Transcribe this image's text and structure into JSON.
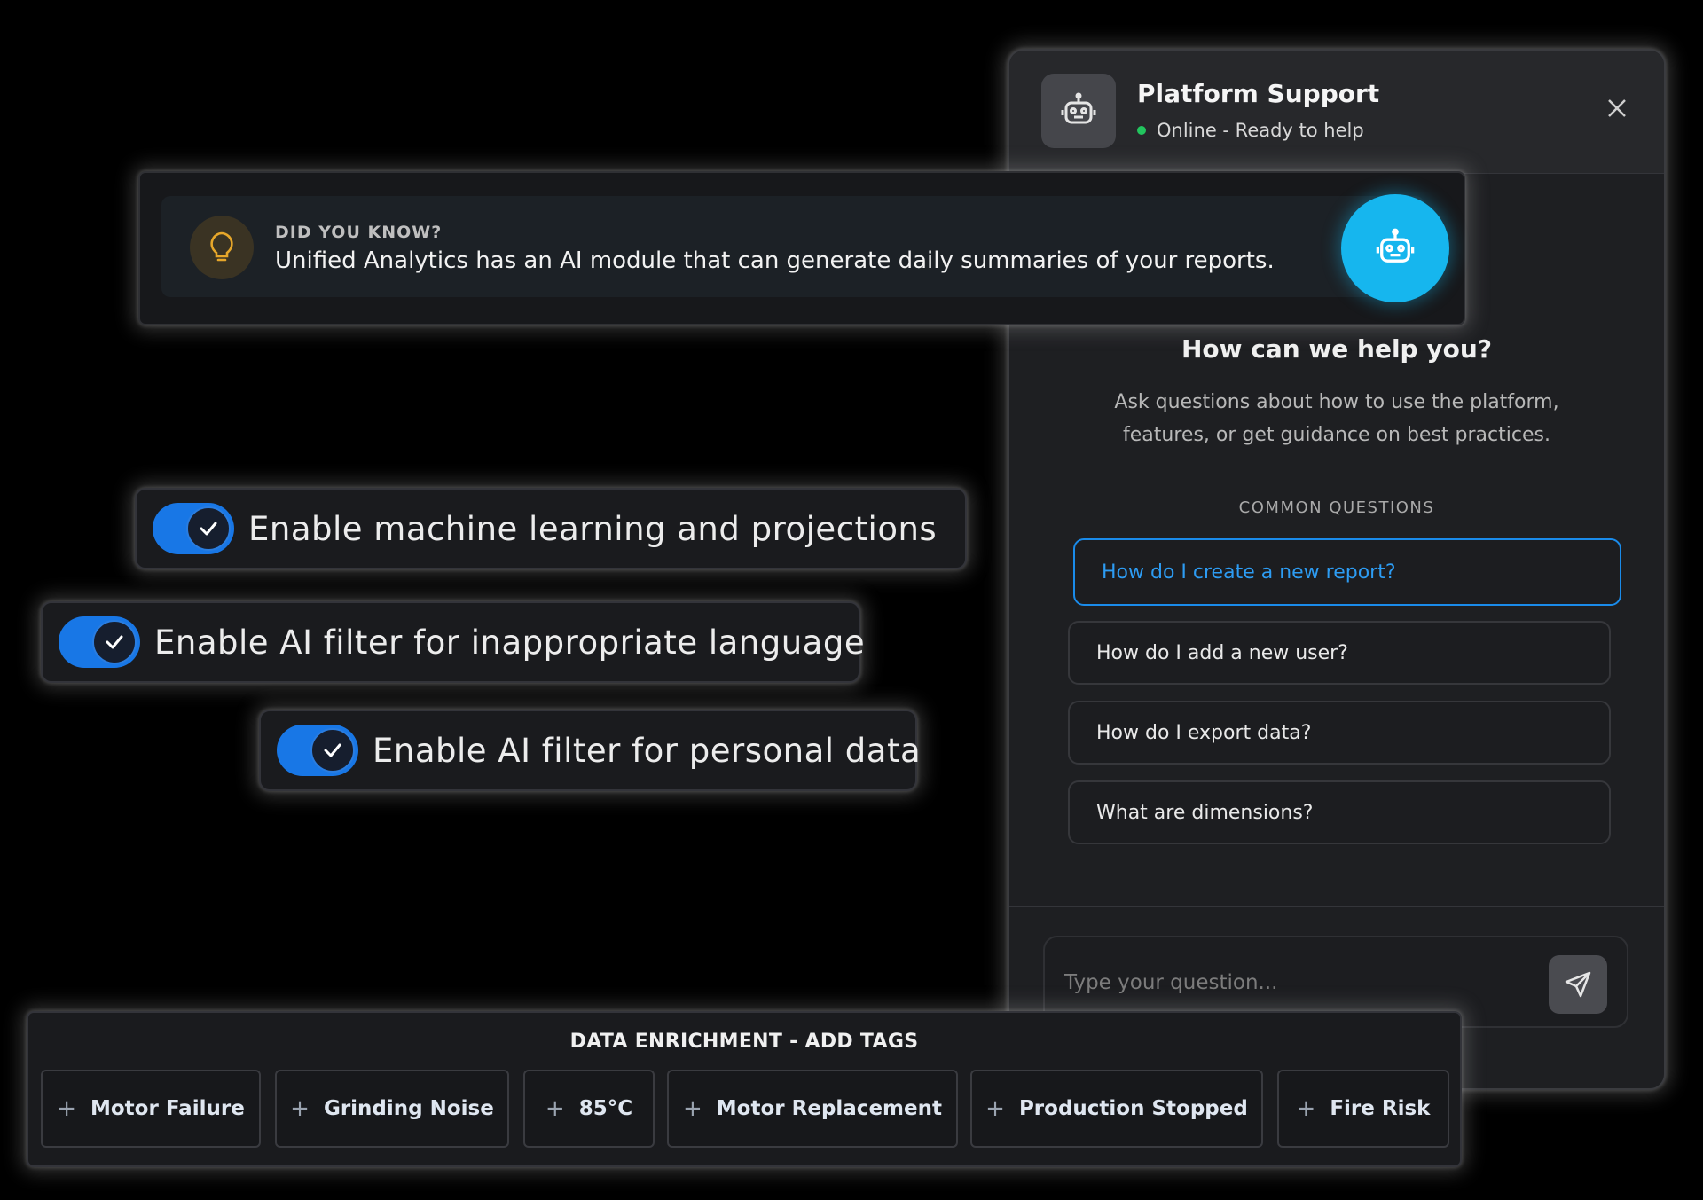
{
  "support": {
    "title": "Platform Support",
    "status": "Online - Ready to help",
    "help_title": "How can we help you?",
    "help_subtitle": "Ask questions about how to use the platform, features, or get guidance on best practices.",
    "common_label": "COMMON QUESTIONS",
    "questions": [
      "How do I create a new report?",
      "How do I add a new user?",
      "How do I export data?",
      "What are dimensions?"
    ],
    "input_placeholder": "Type your question...",
    "icons": {
      "avatar": "robot-icon",
      "close": "close-icon",
      "send": "send-icon"
    }
  },
  "tip": {
    "label": "DID YOU KNOW?",
    "text": "Unified Analytics has an AI module that can generate daily summaries of your reports."
  },
  "toggles": [
    {
      "label": "Enable machine learning and projections",
      "on": true
    },
    {
      "label": "Enable AI filter for inappropriate language",
      "on": true
    },
    {
      "label": "Enable AI filter for personal data",
      "on": true
    }
  ],
  "tags": {
    "header": "DATA ENRICHMENT - ADD TAGS",
    "plus": "+",
    "items": [
      "Motor Failure",
      "Grinding Noise",
      "85°C",
      "Motor Replacement",
      "Production Stopped",
      "Fire Risk"
    ]
  },
  "colors": {
    "accent": "#1877e6",
    "bot": "#16b6ee",
    "online": "#22c55e",
    "link": "#2d9cf3"
  }
}
